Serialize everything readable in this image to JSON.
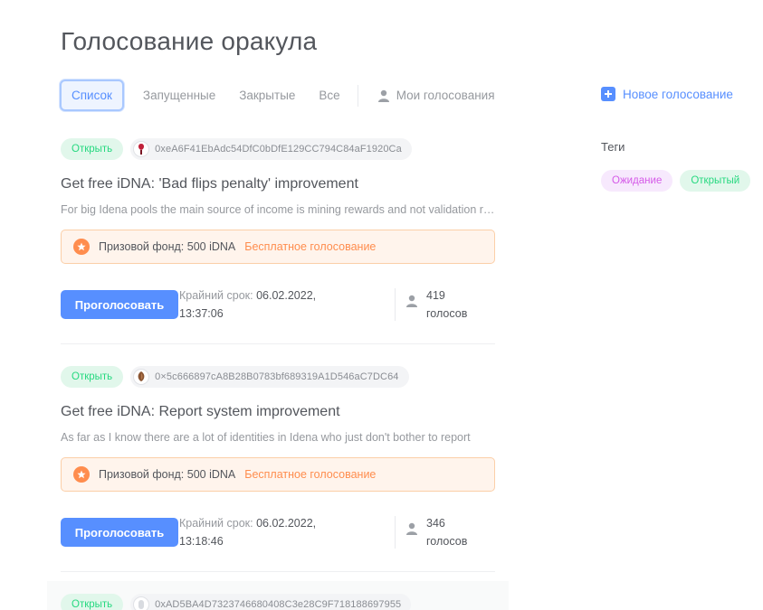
{
  "page": {
    "title": "Голосование оракула"
  },
  "tabs": [
    {
      "label": "Список",
      "active": true
    },
    {
      "label": "Запущенные"
    },
    {
      "label": "Закрытые"
    },
    {
      "label": "Все"
    }
  ],
  "my_votes": {
    "label": "Мои голосования",
    "icon": "user-icon"
  },
  "new_vote": {
    "label": "Новое голосование",
    "icon": "plus-icon"
  },
  "tags": {
    "title": "Теги",
    "items": [
      {
        "label": "Ожидание",
        "color": "#d55ae8"
      },
      {
        "label": "Открытый",
        "color": "#27d980"
      }
    ]
  },
  "votings": [
    {
      "status": "Открыть",
      "address": "0xeA6F41EbAdc54DfC0bDfE129CC794C84aF1920Ca",
      "title": "Get free iDNA: 'Bad flips penalty' improvement",
      "description": "For big Idena pools the main source of income is mining rewards and not validation rewards",
      "prize": "Призовой фонд: 500 iDNA",
      "free": "Бесплатное голосование",
      "vote_label": "Проголосовать",
      "deadline_label": "Крайний срок:",
      "deadline_value": "06.02.2022,",
      "deadline_time": "13:37:06",
      "votes_count": "419",
      "votes_label": "голосов"
    },
    {
      "status": "Открыть",
      "address": "0×5c666897cA8B28B0783bf689319A1D546aC7DC64",
      "title": "Get free iDNA: Report system improvement",
      "description": "As far as I know there are a lot of identities in Idena who just don't bother to report",
      "prize": "Призовой фонд: 500 iDNA",
      "free": "Бесплатное голосование",
      "vote_label": "Проголосовать",
      "deadline_label": "Крайний срок:",
      "deadline_value": "06.02.2022,",
      "deadline_time": "13:18:46",
      "votes_count": "346",
      "votes_label": "голосов"
    },
    {
      "status": "Открыть",
      "address": "0xAD5BA4D7323746680408C3e28C9F718188697955"
    }
  ],
  "colors": {
    "accent": "#578fff",
    "open": "#27d980",
    "prize": "#ff8d4e"
  }
}
